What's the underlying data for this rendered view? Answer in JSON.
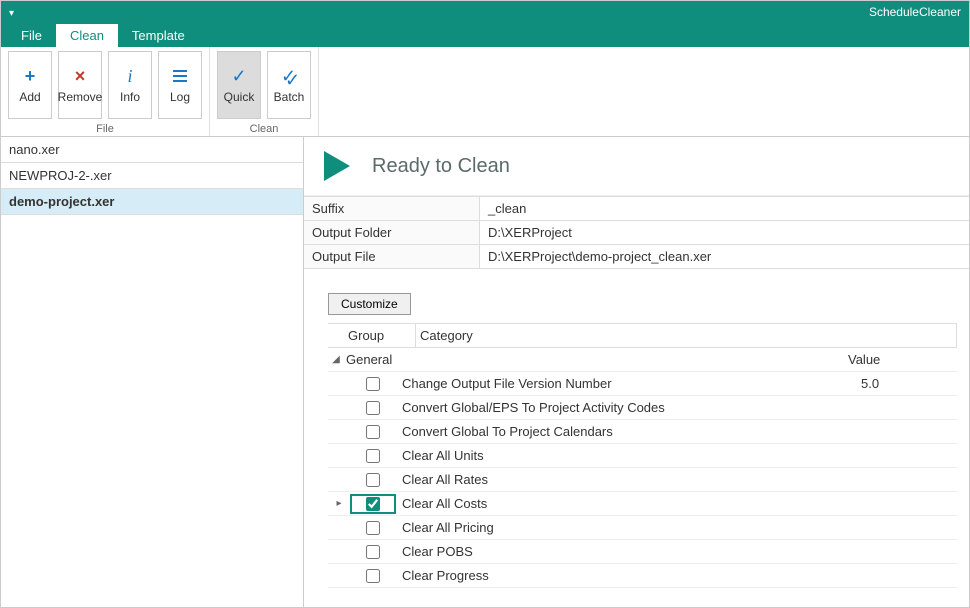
{
  "app_title": "ScheduleCleaner",
  "tabs": {
    "file": "File",
    "clean": "Clean",
    "template": "Template",
    "active": "clean"
  },
  "ribbon": {
    "groups": [
      {
        "label": "File",
        "buttons": [
          "Add",
          "Remove",
          "Info",
          "Log"
        ]
      },
      {
        "label": "Clean",
        "buttons": [
          "Quick",
          "Batch"
        ],
        "selected": "Quick"
      }
    ]
  },
  "files": {
    "items": [
      "nano.xer",
      "NEWPROJ-2-.xer",
      "demo-project.xer"
    ],
    "selected": "demo-project.xer"
  },
  "ready": {
    "title": "Ready to Clean"
  },
  "props": {
    "rows": [
      {
        "k": "Suffix",
        "v": "_clean"
      },
      {
        "k": "Output Folder",
        "v": "D:\\XERProject"
      },
      {
        "k": "Output File",
        "v": "D:\\XERProject\\demo-project_clean.xer"
      }
    ]
  },
  "customize_label": "Customize",
  "grid": {
    "head": {
      "group": "Group",
      "category": "Category"
    },
    "group_label": "General",
    "value_header": "Value",
    "rows": [
      {
        "checked": false,
        "expand": false,
        "label": "Change Output File Version Number",
        "value": "5.0"
      },
      {
        "checked": false,
        "expand": false,
        "label": "Convert Global/EPS To Project Activity Codes",
        "value": ""
      },
      {
        "checked": false,
        "expand": false,
        "label": "Convert Global To Project Calendars",
        "value": ""
      },
      {
        "checked": false,
        "expand": false,
        "label": "Clear All Units",
        "value": ""
      },
      {
        "checked": false,
        "expand": false,
        "label": "Clear All Rates",
        "value": ""
      },
      {
        "checked": true,
        "expand": true,
        "label": "Clear All Costs",
        "value": "",
        "highlight": true
      },
      {
        "checked": false,
        "expand": false,
        "label": "Clear All Pricing",
        "value": ""
      },
      {
        "checked": false,
        "expand": false,
        "label": "Clear POBS",
        "value": ""
      },
      {
        "checked": false,
        "expand": false,
        "label": "Clear Progress",
        "value": ""
      }
    ]
  }
}
